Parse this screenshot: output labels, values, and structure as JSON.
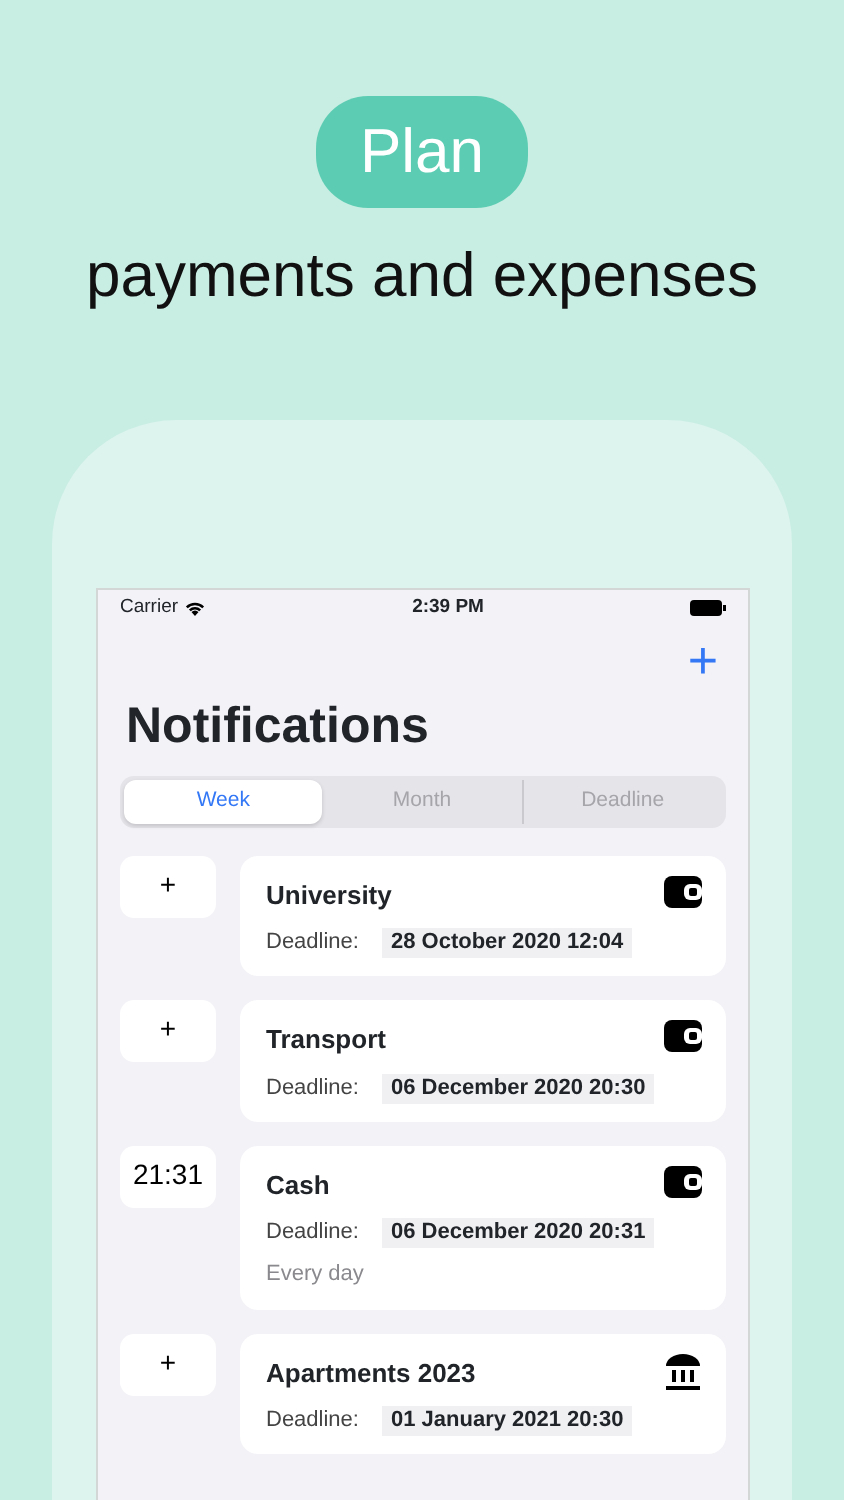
{
  "promo": {
    "badge": "Plan",
    "headline": "payments and expenses"
  },
  "status_bar": {
    "carrier": "Carrier",
    "time": "2:39 PM"
  },
  "nav": {
    "add_button": "+",
    "title": "Notifications"
  },
  "segments": [
    {
      "label": "Week",
      "selected": true
    },
    {
      "label": "Month",
      "selected": false
    },
    {
      "label": "Deadline",
      "selected": false
    }
  ],
  "items": [
    {
      "left": "+",
      "title": "University",
      "kind": "wallet",
      "deadline_label": "Deadline:",
      "deadline": "28 October 2020 12:04"
    },
    {
      "left": "+",
      "title": "Transport",
      "kind": "wallet",
      "deadline_label": "Deadline:",
      "deadline": "06 December 2020 20:30"
    },
    {
      "left": "21:31",
      "title": "Cash",
      "kind": "wallet",
      "deadline_label": "Deadline:",
      "deadline": "06 December 2020 20:31",
      "repeat": "Every day"
    },
    {
      "left": "+",
      "title": "Apartments 2023",
      "kind": "bank",
      "deadline_label": "Deadline:",
      "deadline": "01 January 2021 20:30"
    }
  ]
}
